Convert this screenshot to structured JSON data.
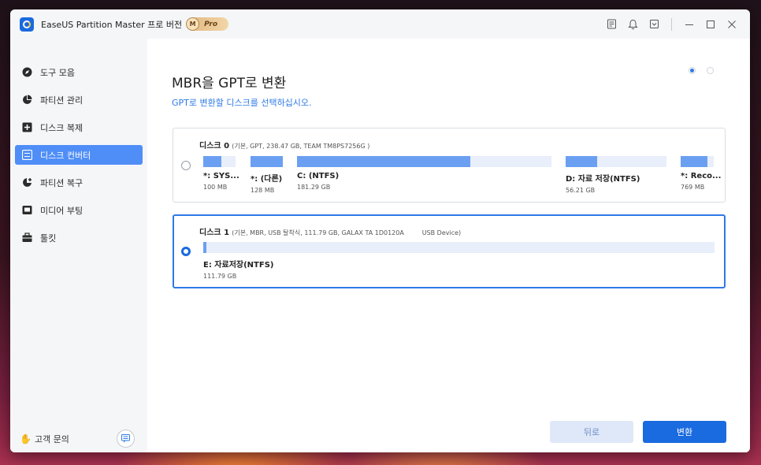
{
  "app": {
    "title": "EaseUS Partition Master 프로 버전",
    "badge_m": "M",
    "badge_pro": "Pro"
  },
  "titlebar_icons": [
    "notes-icon",
    "bell-icon",
    "download-icon",
    "minimize-icon",
    "maximize-icon",
    "close-icon"
  ],
  "sidebar": {
    "items": [
      {
        "label": "도구 모음",
        "icon": "compass-icon"
      },
      {
        "label": "파티션 관리",
        "icon": "pie-icon"
      },
      {
        "label": "디스크 복제",
        "icon": "clone-icon"
      },
      {
        "label": "디스크 컨버터",
        "icon": "converter-icon",
        "active": true
      },
      {
        "label": "파티션 복구",
        "icon": "recover-icon"
      },
      {
        "label": "미디어 부팅",
        "icon": "media-icon"
      },
      {
        "label": "툴킷",
        "icon": "toolbox-icon"
      }
    ],
    "help_label": "고객 문의"
  },
  "main": {
    "title": "MBR을 GPT로 변환",
    "subtitle": "GPT로 변환할 디스크를 선택하십시오.",
    "steps": {
      "total": 2,
      "current": 1
    }
  },
  "disks": [
    {
      "name": "디스크 0",
      "info": "(기본, GPT, 238.47 GB, TEAM TM8PS7256G )",
      "selected": false,
      "partitions": [
        {
          "label": "*: SYS...",
          "size": "100 MB",
          "used": 0.55
        },
        {
          "label": "*: (다른)",
          "size": "128 MB",
          "used": 1.0
        },
        {
          "label": "C: (NTFS)",
          "size": "181.29 GB",
          "used": 0.68
        },
        {
          "label": "D: 자료 저장(NTFS)",
          "size": "56.21 GB",
          "used": 0.31
        },
        {
          "label": "*: Reco...",
          "size": "769 MB",
          "used": 0.82
        }
      ]
    },
    {
      "name": "디스크 1",
      "info": "(기본, MBR, USB 탈착식, 111.79 GB, GALAX TA 1D0120A         USB Device)",
      "selected": true,
      "partitions": [
        {
          "label": "E: 자료저장(NTFS)",
          "size": "111.79 GB",
          "used": 0.003
        }
      ]
    }
  ],
  "buttons": {
    "back": "뒤로",
    "convert": "변환"
  },
  "colors": {
    "accent": "#1a6ae0",
    "bar_fill": "#6b9ff2",
    "bar_empty": "#e8eefa",
    "link": "#2e79e6"
  }
}
